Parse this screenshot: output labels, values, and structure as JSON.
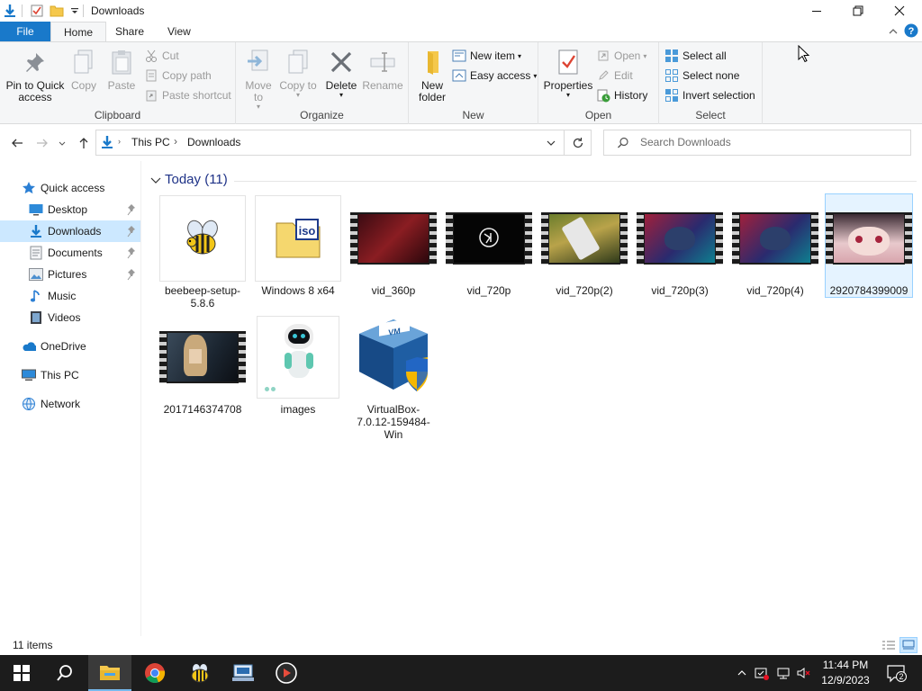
{
  "window": {
    "title": "Downloads",
    "minimize_label": "—",
    "maximize_label": "☐",
    "close_label": "✕"
  },
  "ribbon_tabs": [
    "File",
    "Home",
    "Share",
    "View"
  ],
  "ribbon": {
    "clipboard": {
      "label": "Clipboard",
      "pin": "Pin to Quick access",
      "copy": "Copy",
      "paste": "Paste",
      "cut": "Cut",
      "copy_path": "Copy path",
      "paste_shortcut": "Paste shortcut"
    },
    "organize": {
      "label": "Organize",
      "move_to": "Move to",
      "copy_to": "Copy to",
      "delete": "Delete",
      "rename": "Rename"
    },
    "new": {
      "label": "New",
      "new_folder": "New folder",
      "new_item": "New item",
      "easy_access": "Easy access"
    },
    "open": {
      "label": "Open",
      "properties": "Properties",
      "open": "Open",
      "edit": "Edit",
      "history": "History"
    },
    "select": {
      "label": "Select",
      "select_all": "Select all",
      "select_none": "Select none",
      "invert": "Invert selection"
    }
  },
  "address": {
    "crumbs": [
      "This PC",
      "Downloads"
    ],
    "search_placeholder": "Search Downloads"
  },
  "nav_pane": {
    "items": [
      {
        "label": "Quick access",
        "icon": "star-icon"
      },
      {
        "label": "Desktop",
        "icon": "desktop-icon",
        "pinned": true
      },
      {
        "label": "Downloads",
        "icon": "download-icon",
        "pinned": true,
        "selected": true
      },
      {
        "label": "Documents",
        "icon": "documents-icon",
        "pinned": true
      },
      {
        "label": "Pictures",
        "icon": "pictures-icon",
        "pinned": true
      },
      {
        "label": "Music",
        "icon": "music-icon"
      },
      {
        "label": "Videos",
        "icon": "videos-icon"
      },
      {
        "label": "OneDrive",
        "icon": "cloud-icon"
      },
      {
        "label": "This PC",
        "icon": "computer-icon"
      },
      {
        "label": "Network",
        "icon": "network-icon"
      }
    ]
  },
  "group": {
    "label": "Today (11)"
  },
  "files": [
    {
      "name": "beebeep-setup-5.8.6",
      "kind": "installer"
    },
    {
      "name": "Windows 8 x64",
      "kind": "iso"
    },
    {
      "name": "vid_360p",
      "kind": "video"
    },
    {
      "name": "vid_720p",
      "kind": "video"
    },
    {
      "name": "vid_720p(2)",
      "kind": "video"
    },
    {
      "name": "vid_720p(3)",
      "kind": "video"
    },
    {
      "name": "vid_720p(4)",
      "kind": "video"
    },
    {
      "name": "2920784399009",
      "kind": "video",
      "selected": true
    },
    {
      "name": "2017146374708",
      "kind": "video"
    },
    {
      "name": "images",
      "kind": "image"
    },
    {
      "name": "VirtualBox-7.0.12-159484-Win",
      "kind": "installer"
    }
  ],
  "status": {
    "text": "11 items"
  },
  "taskbar": {
    "clock_time": "11:44 PM",
    "clock_date": "12/9/2023",
    "notification_count": "2"
  },
  "colors": {
    "accent": "#1979ca",
    "selection": "#cce8ff",
    "group_header": "#1e3287",
    "taskbar": "#1c1c1c"
  }
}
